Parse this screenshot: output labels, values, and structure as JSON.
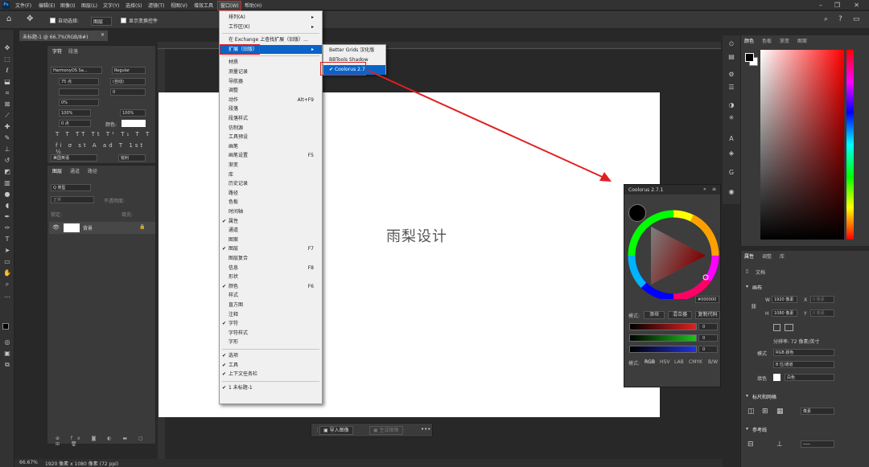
{
  "menubar": {
    "items": [
      "文件(F)",
      "编辑(E)",
      "图像(I)",
      "图层(L)",
      "文字(Y)",
      "选择(S)",
      "滤镜(T)",
      "视图(V)",
      "增效工具",
      "窗口(W)",
      "帮助(H)"
    ]
  },
  "options": {
    "auto_select_label": "自动选择:",
    "auto_select_value": "图层",
    "show_transform_label": "显示变换控件"
  },
  "document": {
    "tab_title": "未标题-1 @ 66.7%(RGB/8#)",
    "canvas_text": "雨梨设计",
    "zoom": "66.67%",
    "status": "1920 像素 x 1080 像素 (72 ppi)"
  },
  "character_panel": {
    "tabs": [
      "字符",
      "段落"
    ],
    "font_family": "HarmonyOS Sa...",
    "font_style": "Regular",
    "size": "75 点",
    "leading": "(自动)",
    "tracking_va": "0",
    "kerning": "0%",
    "scale_v": "100%",
    "scale_h": "100%",
    "baseline": "0 点",
    "color_label": "颜色:",
    "language": "美国英语",
    "aa": "锐利"
  },
  "layers_panel": {
    "tabs": [
      "图层",
      "通道",
      "路径"
    ],
    "filter": "Q 类型",
    "blend": "正常",
    "opacity_label": "不透明度:",
    "lock_label": "锁定:",
    "fill_label": "填充:",
    "layer_name": "背景"
  },
  "window_menu": {
    "items": [
      {
        "label": "排列(A)",
        "arrow": true
      },
      {
        "label": "工作区(K)",
        "arrow": true
      },
      {
        "sep": true
      },
      {
        "label": "在 Exchange 上查找扩展（旧版）..."
      },
      {
        "label": "扩展（旧版）",
        "arrow": true,
        "highlight": true
      },
      {
        "sep": true
      },
      {
        "label": "材质"
      },
      {
        "label": "测量记录"
      },
      {
        "label": "导航器"
      },
      {
        "label": "调整"
      },
      {
        "label": "动作",
        "shortcut": "Alt+F9"
      },
      {
        "label": "段落"
      },
      {
        "label": "段落样式"
      },
      {
        "label": "仿制源"
      },
      {
        "label": "工具预设"
      },
      {
        "label": "画笔"
      },
      {
        "label": "画笔设置",
        "shortcut": "F5"
      },
      {
        "label": "渐变"
      },
      {
        "label": "库"
      },
      {
        "label": "历史记录"
      },
      {
        "label": "路径"
      },
      {
        "label": "色板"
      },
      {
        "label": "时间轴"
      },
      {
        "label": "属性",
        "checked": true
      },
      {
        "label": "通道"
      },
      {
        "label": "图案"
      },
      {
        "label": "图层",
        "checked": true,
        "shortcut": "F7"
      },
      {
        "label": "图层复合"
      },
      {
        "label": "信息",
        "shortcut": "F8"
      },
      {
        "label": "形状"
      },
      {
        "label": "颜色",
        "checked": true,
        "shortcut": "F6"
      },
      {
        "label": "样式"
      },
      {
        "label": "直方图"
      },
      {
        "label": "注释"
      },
      {
        "label": "字符",
        "checked": true
      },
      {
        "label": "字符样式"
      },
      {
        "label": "字形"
      },
      {
        "sep": true
      },
      {
        "label": "选项",
        "checked": true
      },
      {
        "label": "工具",
        "checked": true
      },
      {
        "label": "上下文任务栏",
        "checked": true
      },
      {
        "sep": true
      },
      {
        "label": "1 未标题-1",
        "checked": true
      }
    ]
  },
  "submenu": {
    "items": [
      {
        "label": "Better Grids 汉化版"
      },
      {
        "label": "BBTools Shadow"
      },
      {
        "label": "Coolorus 2.7",
        "checked": true,
        "highlight": true
      }
    ]
  },
  "coolorus": {
    "title": "Coolorus 2.7.1",
    "hex": "#000000",
    "mode_label": "模式:",
    "buttons": [
      "添块",
      "混合器",
      "复制代码"
    ],
    "sliders": [
      {
        "color": "#e02020",
        "value": "0"
      },
      {
        "color": "#20c020",
        "value": "0"
      },
      {
        "color": "#2030e0",
        "value": "0"
      }
    ],
    "mode_tabs": [
      "模式:",
      "RGB",
      "HSV",
      "LAB",
      "CMYK",
      "B/W"
    ]
  },
  "color_panel": {
    "tabs": [
      "颜色",
      "色板",
      "渐变",
      "图案"
    ]
  },
  "properties_panel": {
    "tabs": [
      "属性",
      "调整",
      "库"
    ],
    "doc_label": "文档",
    "canvas_label": "画布",
    "w_label": "W",
    "w_value": "1920 像素",
    "h_label": "H",
    "h_value": "1080 像素",
    "x_label": "X",
    "x_value": "0 像素",
    "y_label": "Y",
    "y_value": "0 像素",
    "resolution": "分辨率: 72 像素/英寸",
    "mode_label": "模式",
    "mode_value": "RGB 颜色",
    "depth_value": "8 位/通道",
    "fill_label": "填色",
    "fill_value": "白色",
    "rulers_label": "标尺和网格",
    "units_value": "像素",
    "guides_label": "参考线"
  },
  "floatbar": {
    "import": "导入图像",
    "generate": "生成图像"
  }
}
